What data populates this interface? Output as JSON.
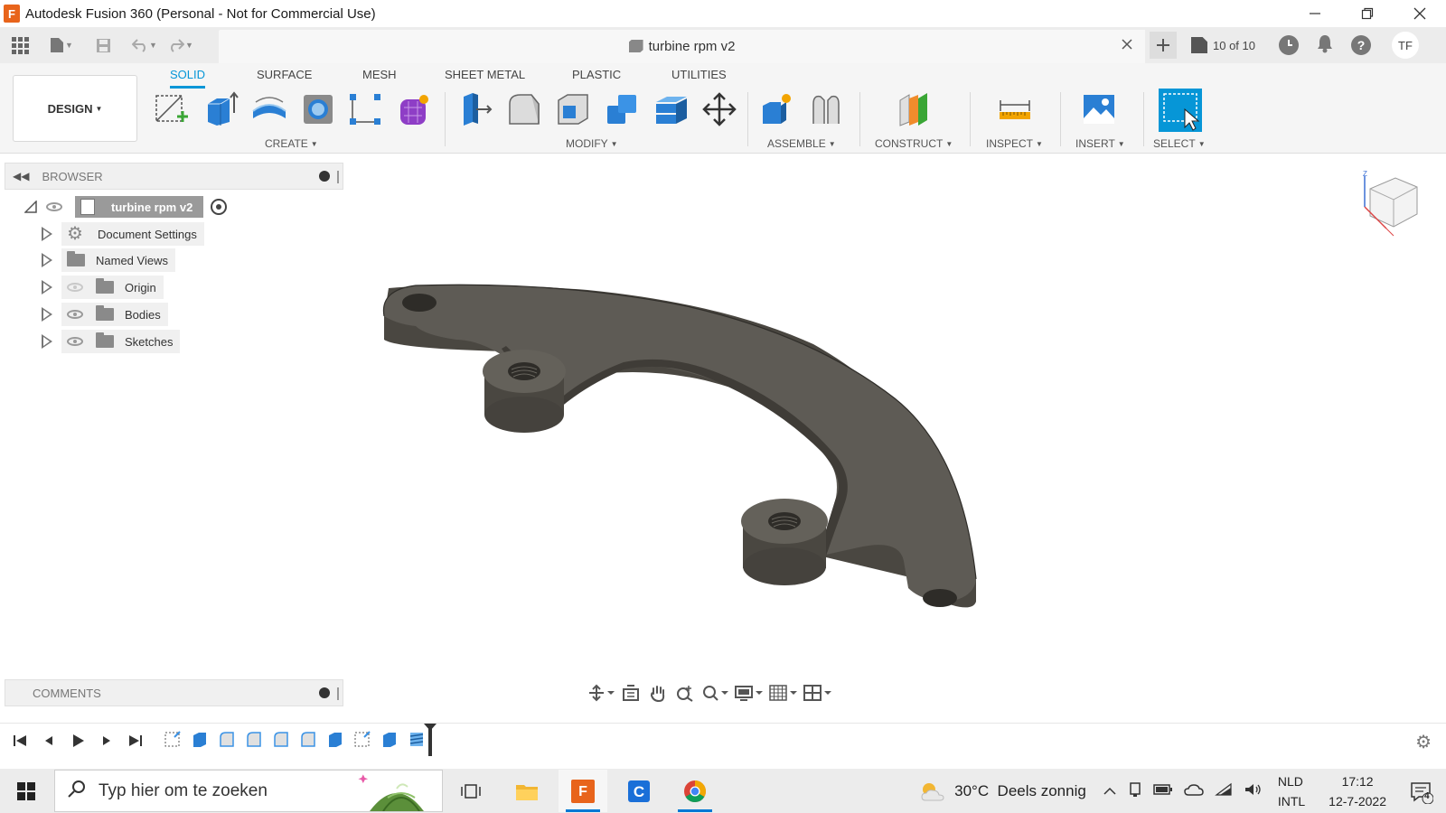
{
  "window": {
    "title": "Autodesk Fusion 360 (Personal - Not for Commercial Use)",
    "logo_letter": "F"
  },
  "appbar": {
    "doc_title": "turbine rpm v2",
    "versions": "10 of 10",
    "user_initials": "TF"
  },
  "ribbon": {
    "workspace": "DESIGN",
    "tabs": [
      "SOLID",
      "SURFACE",
      "MESH",
      "SHEET METAL",
      "PLASTIC",
      "UTILITIES"
    ],
    "active_tab": "SOLID",
    "groups": [
      "CREATE",
      "MODIFY",
      "ASSEMBLE",
      "CONSTRUCT",
      "INSPECT",
      "INSERT",
      "SELECT"
    ]
  },
  "browser": {
    "title": "BROWSER",
    "root": "turbine rpm v2",
    "items": [
      "Document Settings",
      "Named Views",
      "Origin",
      "Bodies",
      "Sketches"
    ]
  },
  "comments": {
    "title": "COMMENTS"
  },
  "taskbar": {
    "search_placeholder": "Typ hier om te zoeken",
    "weather": "30°C  Deels zonnig",
    "lang_1": "NLD",
    "lang_2": "INTL",
    "time": "17:12",
    "date": "12-7-2022",
    "notif_count": "4"
  },
  "colors": {
    "accent": "#0696d7",
    "body": "#5e5b55",
    "body_dark": "#45423d",
    "fusion_orange": "#e8641b"
  }
}
